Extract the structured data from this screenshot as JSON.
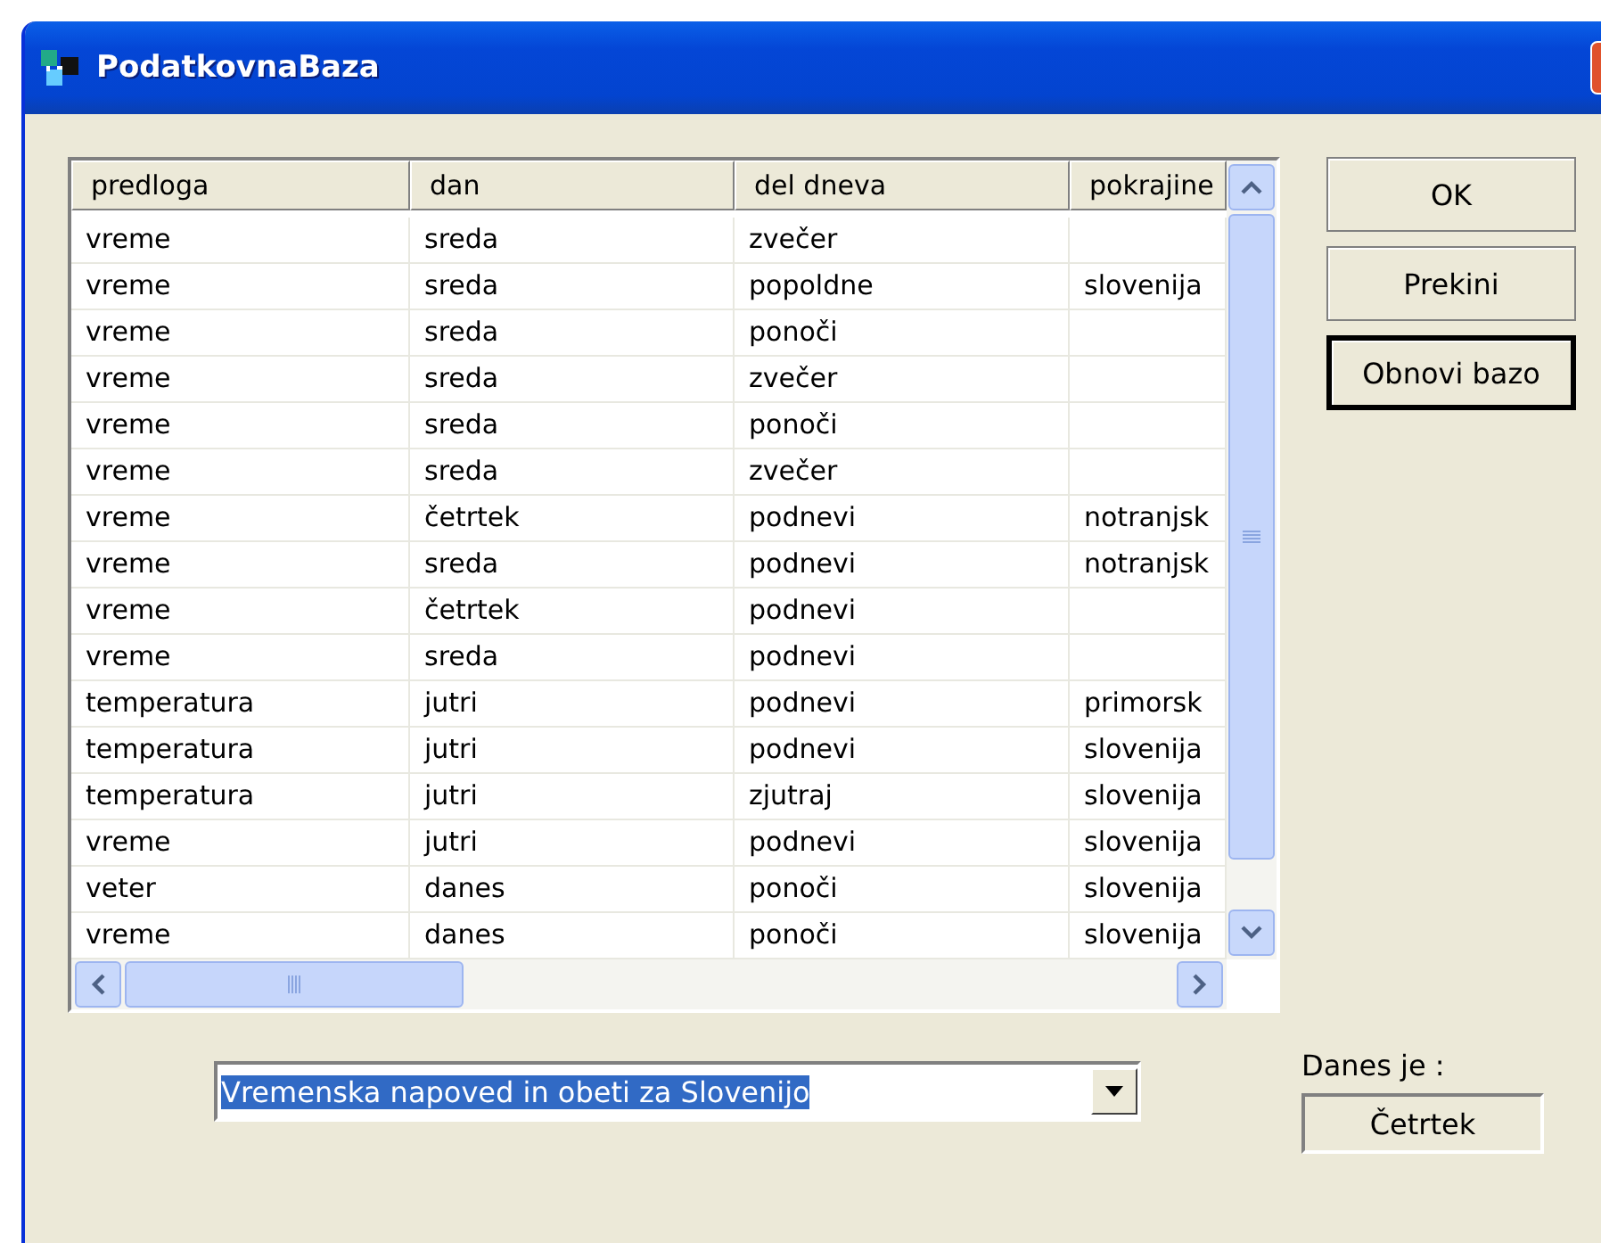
{
  "window": {
    "title": "PodatkovnaBaza"
  },
  "table": {
    "columns": [
      "predloga",
      "dan",
      "del dneva",
      "pokrajine"
    ],
    "rows": [
      [
        "vreme",
        "sreda",
        "zvečer",
        ""
      ],
      [
        "vreme",
        "sreda",
        "popoldne",
        "slovenija"
      ],
      [
        "vreme",
        "sreda",
        "ponoči",
        ""
      ],
      [
        "vreme",
        "sreda",
        "zvečer",
        ""
      ],
      [
        "vreme",
        "sreda",
        "ponoči",
        ""
      ],
      [
        "vreme",
        "sreda",
        "zvečer",
        ""
      ],
      [
        "vreme",
        "četrtek",
        "podnevi",
        "notranjsk"
      ],
      [
        "vreme",
        "sreda",
        "podnevi",
        "notranjsk"
      ],
      [
        "vreme",
        "četrtek",
        "podnevi",
        ""
      ],
      [
        "vreme",
        "sreda",
        "podnevi",
        ""
      ],
      [
        "temperatura",
        "jutri",
        "podnevi",
        "primorsk"
      ],
      [
        "temperatura",
        "jutri",
        "podnevi",
        "slovenija"
      ],
      [
        "temperatura",
        "jutri",
        "zjutraj",
        "slovenija"
      ],
      [
        "vreme",
        "jutri",
        "podnevi",
        "slovenija"
      ],
      [
        "veter",
        "danes",
        "ponoči",
        "slovenija"
      ],
      [
        "vreme",
        "danes",
        "ponoči",
        "slovenija"
      ]
    ]
  },
  "buttons": [
    {
      "label": "OK",
      "focused": false
    },
    {
      "label": "Prekini",
      "focused": false
    },
    {
      "label": "Obnovi bazo",
      "focused": true
    }
  ],
  "template_combo": {
    "value": "Vremenska napoved in obeti za Slovenijo",
    "selected": true
  },
  "today": {
    "label": "Danes je :",
    "value": "Četrtek"
  }
}
